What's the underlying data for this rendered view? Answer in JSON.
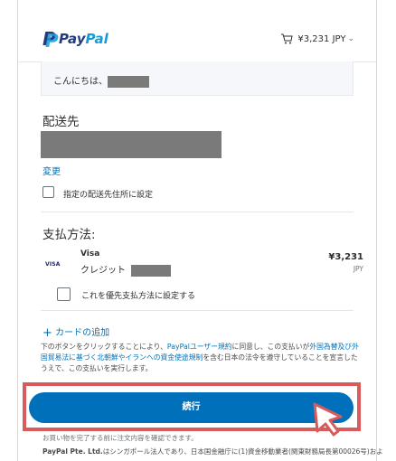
{
  "header": {
    "brand_part1": "Pay",
    "brand_part2": "Pal",
    "cart_amount": "¥3,231 JPY",
    "cart_icon": "cart-icon",
    "dropdown_icon": "chevron-down-icon"
  },
  "greeting": {
    "text": "こんにちは、"
  },
  "shipping": {
    "title": "配送先",
    "change_link": "変更",
    "set_default_label": "指定の配送先住所に設定"
  },
  "payment": {
    "title": "支払方法:",
    "card_brand": "Visa",
    "card_badge": "VISA",
    "card_type": "クレジット",
    "amount": "¥3,231",
    "currency": "JPY",
    "set_preferred_label": "これを優先支払方法に設定する",
    "add_card_label": "カードの追加"
  },
  "legal": {
    "p1_a": "下のボタンをクリックすることにより、",
    "p1_link1": "PayPalユーザー規約",
    "p1_b": "に同意し、この支払いが",
    "p1_link2": "外国為替及び外国貿易法に基づく北朝鮮やイランへの資金使途規制",
    "p1_c": "を含む日本の法令を遵守していることを宣言したうえで、この支払いを実行します。"
  },
  "actions": {
    "continue_label": "続行"
  },
  "footer": {
    "note": "お買い物を完了する前に注文内容を確認できます。",
    "company": "PayPal Pte. Ltd.",
    "company_rest": "はシンガポール法人であり、日本国金融庁に(1)資金移動業者(関東財務局長第00026号)およ"
  },
  "colors": {
    "accent": "#0070ba",
    "highlight": "#d95a5a"
  }
}
